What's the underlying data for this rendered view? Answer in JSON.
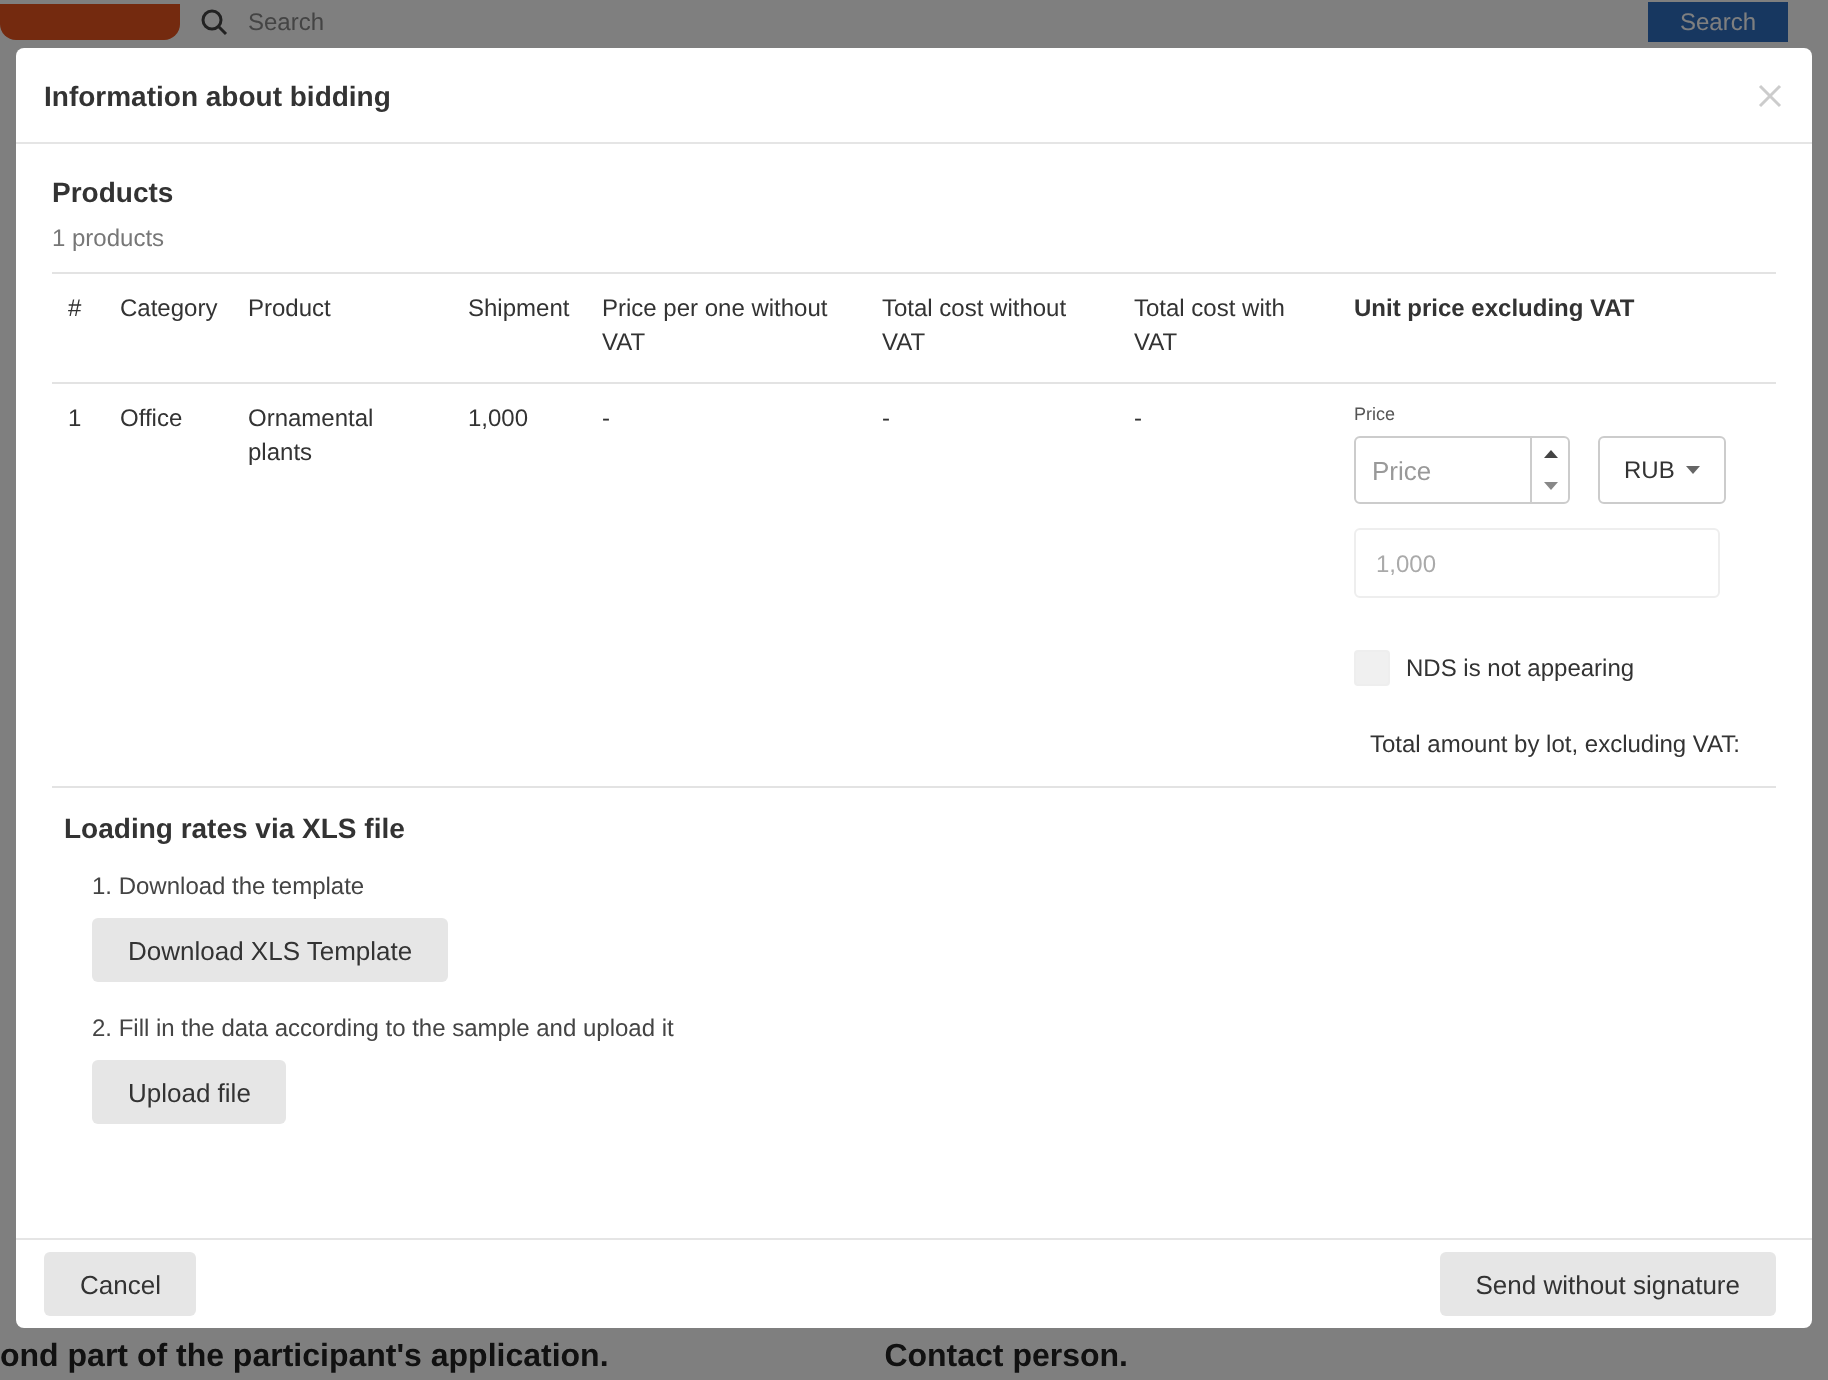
{
  "background": {
    "search_placeholder": "Search",
    "search_button": "Search",
    "headings": [
      "ond part of the participant's application.",
      "Contact person."
    ]
  },
  "dialog": {
    "title": "Information about bidding"
  },
  "products": {
    "heading": "Products",
    "count": "1 products",
    "columns": [
      {
        "label": "#",
        "kind": "data"
      },
      {
        "label": "Category",
        "kind": "data"
      },
      {
        "label": "Product",
        "kind": "data"
      },
      {
        "label": "Shipment",
        "kind": "data"
      },
      {
        "label": "Price per one without VAT",
        "kind": "data"
      },
      {
        "label": "Total cost without VAT",
        "kind": "data"
      },
      {
        "label": "Total cost with VAT",
        "kind": "data"
      },
      {
        "label": "Unit price excluding VAT",
        "kind": "input"
      }
    ],
    "rows": [
      {
        "cells": [
          "1",
          "Office",
          "Ornamental plants",
          "1,000",
          "-",
          "-",
          "-"
        ],
        "price_label": "Price",
        "price_placeholder": "Price",
        "currency": "RUB",
        "converted_placeholder": "1,000",
        "nds": {
          "label": "NDS is not appearing",
          "checked": false
        }
      }
    ],
    "total_label": "Total amount by lot, excluding VAT:"
  },
  "xls": {
    "heading": "Loading rates via XLS file",
    "steps": [
      {
        "text": "1. Download the template",
        "button": "Download XLS Template"
      },
      {
        "text": "2. Fill in the data according to the sample and upload it",
        "button": "Upload file"
      }
    ]
  },
  "footer": {
    "buttons": [
      {
        "label": "Cancel"
      },
      {
        "label": "Send without signature"
      }
    ]
  }
}
